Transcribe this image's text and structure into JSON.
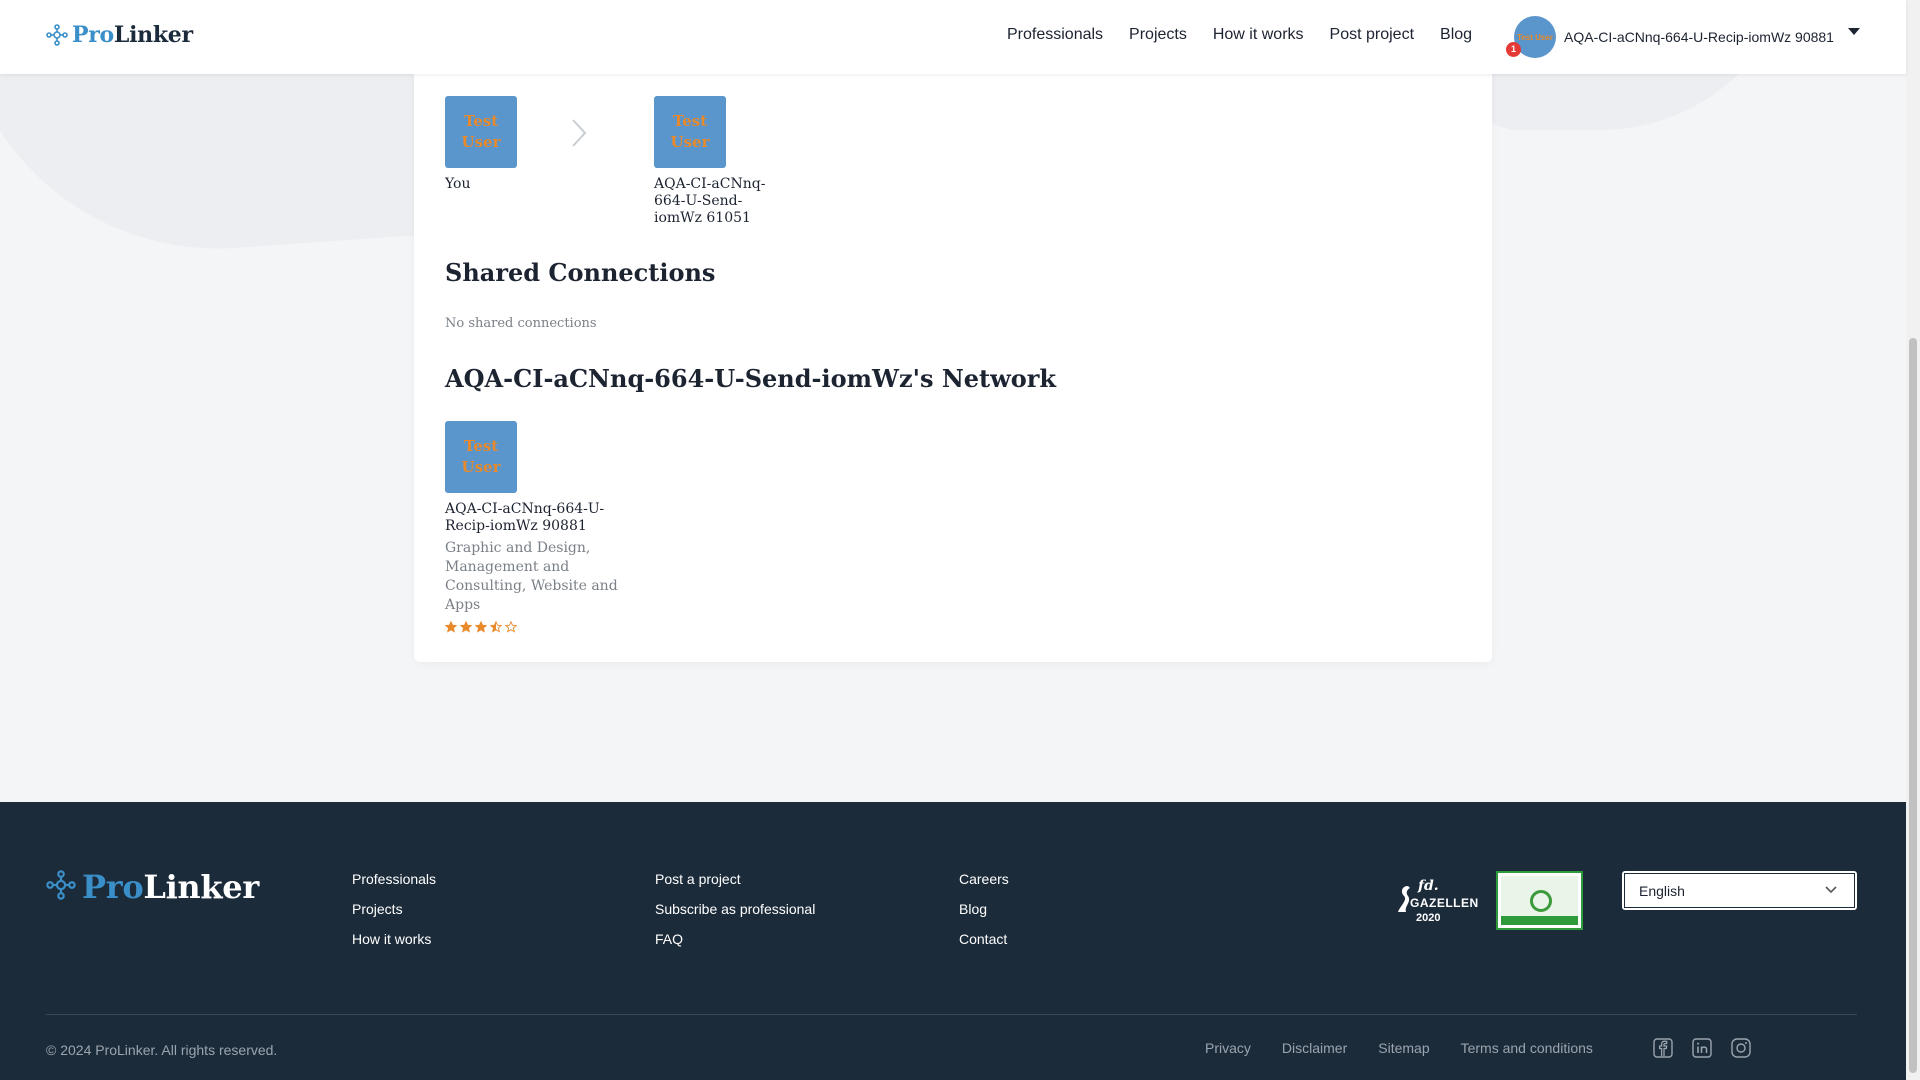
{
  "header": {
    "logo_pro": "Pro",
    "logo_linker": "Linker",
    "nav": [
      "Professionals",
      "Projects",
      "How it works",
      "Post project",
      "Blog"
    ],
    "user": {
      "avatar_text": "Test User",
      "notification_count": "1",
      "name": "AQA-CI-aCNnq-664-U-Recip-iomWz 90881"
    }
  },
  "connection_path": {
    "you": {
      "tile_text": "Test User",
      "label": "You"
    },
    "target": {
      "tile_text": "Test User",
      "label": "AQA-CI-aCNnq-664-U-Send-iomWz 61051"
    }
  },
  "shared_connections": {
    "title": "Shared Connections",
    "empty_text": "No shared connections"
  },
  "network": {
    "title": "AQA-CI-aCNnq-664-U-Send-iomWz's Network",
    "items": [
      {
        "tile_text": "Test User",
        "name": "AQA-CI-aCNnq-664-U-Recip-iomWz 90881",
        "skills": "Graphic and Design, Management and Consulting, Website and Apps",
        "rating": 3.5,
        "rating_max": 5
      }
    ]
  },
  "footer": {
    "logo_pro": "Pro",
    "logo_linker": "Linker",
    "col1": [
      "Professionals",
      "Projects",
      "How it works"
    ],
    "col2": [
      "Post a project",
      "Subscribe as professional",
      "FAQ"
    ],
    "col3": [
      "Careers",
      "Blog",
      "Contact"
    ],
    "award_fd": {
      "brand": "fd.",
      "title": "GAZELLEN",
      "year": "2020"
    },
    "language": "English",
    "copyright": "© 2024 ProLinker. All rights reserved.",
    "bottom_links": [
      "Privacy",
      "Disclaimer",
      "Sitemap",
      "Terms and conditions"
    ],
    "socials": [
      "facebook-icon",
      "linkedin-icon",
      "instagram-icon"
    ]
  },
  "colors": {
    "brand_blue": "#3a8fc9",
    "tile_blue": "#5a95cc",
    "tile_text": "#e8892a",
    "footer_bg": "#1c2b3a",
    "star": "#e8892a"
  }
}
